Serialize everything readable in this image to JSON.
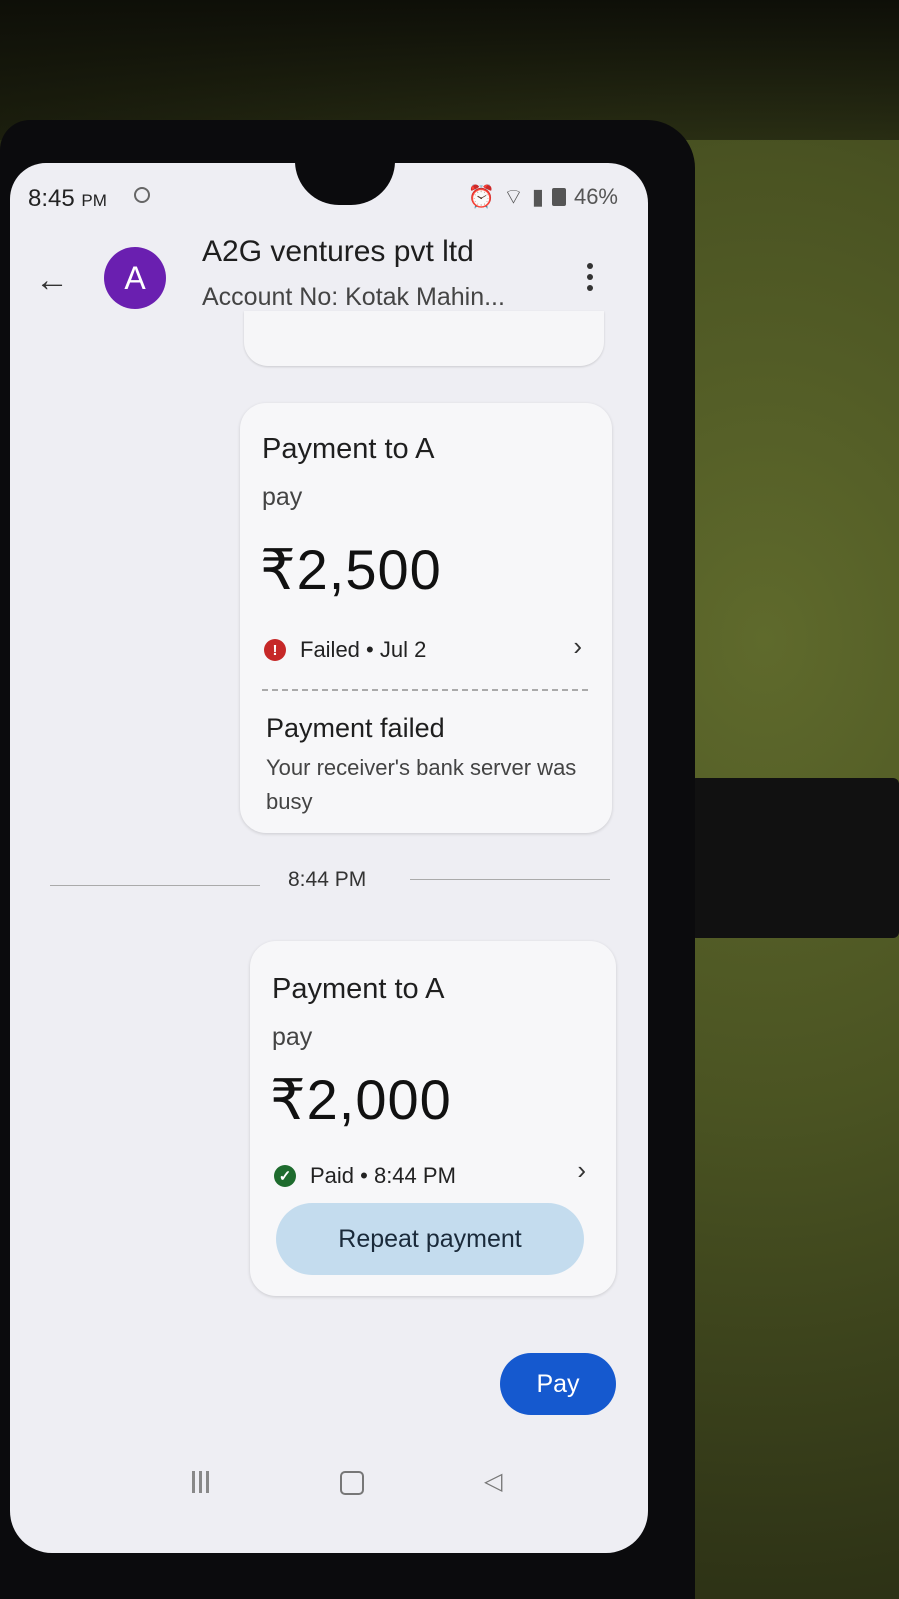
{
  "status_bar": {
    "time": "8:45",
    "time_suffix": "PM",
    "battery": "46%"
  },
  "header": {
    "avatar_letter": "A",
    "title": "A2G ventures pvt ltd",
    "subtitle": "Account No: Kotak Mahin..."
  },
  "payments": [
    {
      "title": "Payment to A",
      "memo": "pay",
      "amount": "₹2,500",
      "status": "Failed • Jul 2",
      "failure_title": "Payment failed",
      "failure_desc": "Your receiver's bank server was busy"
    },
    {
      "title": "Payment to A",
      "memo": "pay",
      "amount": "₹2,000",
      "status": "Paid • 8:44 PM",
      "action": "Repeat payment"
    }
  ],
  "separator_time": "8:44 PM",
  "pay_button": "Pay",
  "icons": {
    "failed": "!",
    "paid": "✓",
    "chevron": "›",
    "back": "←"
  },
  "colors": {
    "avatar": "#6a1fb0",
    "failed": "#c62828",
    "paid": "#1e6b2e",
    "pay_button": "#1559cf",
    "repeat_button": "#c4dcee"
  }
}
